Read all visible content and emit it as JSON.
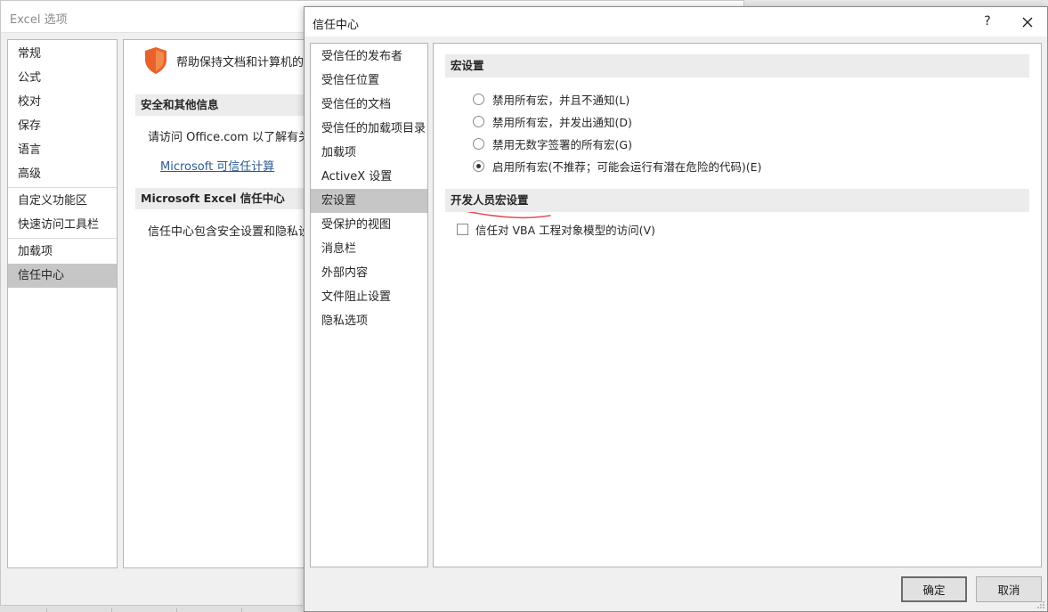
{
  "background_window": {
    "title": "Excel 选项",
    "nav_items": [
      "常规",
      "公式",
      "校对",
      "保存",
      "语言",
      "高级",
      "自定义功能区",
      "快速访问工具栏",
      "加载项",
      "信任中心"
    ],
    "active_nav": "信任中心",
    "hero_text": "帮助保持文档和计算机的",
    "section_security": "安全和其他信息",
    "visit_text": "请访问 Office.com 以了解有关",
    "link_text": "Microsoft 可信任计算",
    "section_trust_center": "Microsoft Excel 信任中心",
    "trust_center_desc": "信任中心包含安全设置和隐私设置"
  },
  "dialog": {
    "title": "信任中心",
    "help_label": "?",
    "close_label": "✕",
    "nav_items": [
      "受信任的发布者",
      "受信任位置",
      "受信任的文档",
      "受信任的加载项目录",
      "加载项",
      "ActiveX 设置",
      "宏设置",
      "受保护的视图",
      "消息栏",
      "外部内容",
      "文件阻止设置",
      "隐私选项"
    ],
    "active_nav": "宏设置",
    "macro_section": {
      "header": "宏设置",
      "options": [
        {
          "label": "禁用所有宏，并且不通知(L)",
          "checked": false
        },
        {
          "label": "禁用所有宏，并发出通知(D)",
          "checked": false
        },
        {
          "label": "禁用无数字签署的所有宏(G)",
          "checked": false
        },
        {
          "label": "启用所有宏(不推荐；可能会运行有潜在危险的代码)(E)",
          "checked": true
        }
      ]
    },
    "developer_section": {
      "header": "开发人员宏设置",
      "checkbox_label": "信任对 VBA 工程对象模型的访问(V)",
      "checkbox_checked": false
    },
    "ok_label": "确定",
    "cancel_label": "取消"
  },
  "colors": {
    "annotation_underline": "#e0505a",
    "shield_orange": "#e8622a",
    "active_nav_bg": "#c6c6c6",
    "link": "#2e5b8f"
  }
}
